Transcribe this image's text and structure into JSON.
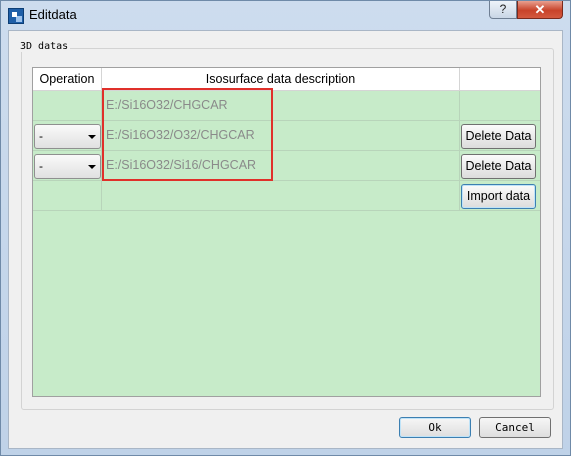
{
  "window": {
    "title": "Editdata",
    "help_label": "?",
    "close_label": "✕"
  },
  "group": {
    "title": "3D datas"
  },
  "table": {
    "columns": [
      "Operation",
      "Isosurface data description",
      ""
    ],
    "rows": [
      {
        "operation": "",
        "path": "E:/Si16O32/CHGCAR",
        "action": ""
      },
      {
        "operation": "-",
        "path": "E:/Si16O32/O32/CHGCAR",
        "action": "Delete Data"
      },
      {
        "operation": "-",
        "path": "E:/Si16O32/Si16/CHGCAR",
        "action": "Delete Data"
      },
      {
        "operation": "",
        "path": "",
        "action": "Import data"
      }
    ]
  },
  "buttons": {
    "ok": "Ok",
    "cancel": "Cancel"
  },
  "colors": {
    "table_bg": "#c7ebc9",
    "highlight": "#e0302a",
    "close_button": "#c8432a"
  },
  "icons": {
    "app": "app-icon",
    "combo_arrow": "arrow-down-icon"
  }
}
